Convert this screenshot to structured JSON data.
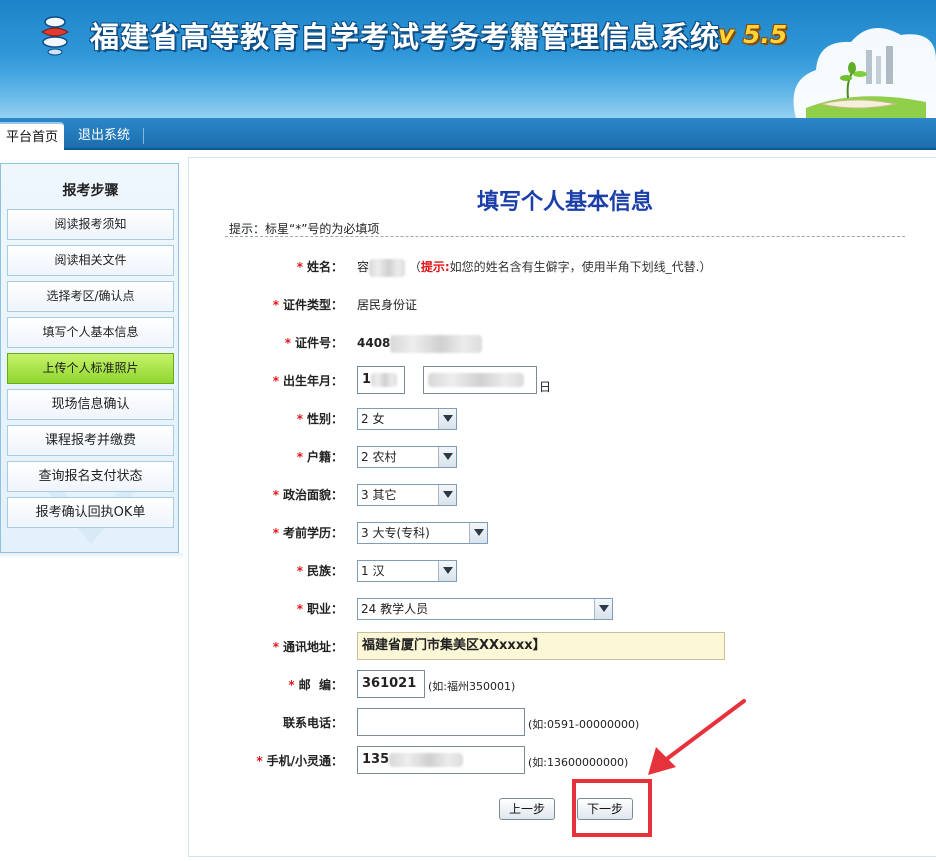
{
  "header": {
    "title": "福建省高等教育自学考试考务考籍管理信息系统",
    "version": "v 5.5"
  },
  "nav": {
    "tabs": [
      {
        "label": "平台首页",
        "active": true
      },
      {
        "label": "退出系统",
        "active": false
      }
    ]
  },
  "sidebar": {
    "title": "报考步骤",
    "steps": [
      {
        "label": "阅读报考须知"
      },
      {
        "label": "阅读相关文件"
      },
      {
        "label": "选择考区/确认点"
      },
      {
        "label": "填写个人基本信息"
      },
      {
        "label": "上传个人标准照片"
      },
      {
        "label": "现场信息确认"
      },
      {
        "label": "课程报考并缴费"
      },
      {
        "label": "查询报名支付状态"
      },
      {
        "label": "报考确认回执OK单"
      }
    ],
    "active_step": "上传个人标准照片"
  },
  "form": {
    "title": "填写个人基本信息",
    "hint": "提示：标星“*”号的为必填项",
    "required_mark": "*",
    "name": {
      "label": "姓名：",
      "value_visible": "容",
      "tip_label": "提示:",
      "tip_text": "如您的姓名含有生僻字，使用半角下划线_代替.）",
      "tip_open": "（"
    },
    "id_type": {
      "label": "证件类型：",
      "value": "居民身份证"
    },
    "id_number": {
      "label": "证件号：",
      "value_visible": "4408"
    },
    "birth": {
      "label": "出生年月：",
      "year_visible": "1",
      "day_suffix": "日"
    },
    "gender": {
      "label": "性别：",
      "value": "2 女"
    },
    "hukou": {
      "label": "户籍：",
      "value": "2 农村"
    },
    "politics": {
      "label": "政治面貌：",
      "value": "3 其它"
    },
    "education": {
      "label": "考前学历：",
      "value": "3 大专(专科)"
    },
    "ethnicity": {
      "label": "民族：",
      "value": "1 汉"
    },
    "occupation": {
      "label": "职业：",
      "value": "24 教学人员"
    },
    "address": {
      "label": "通讯地址：",
      "value": "福建省厦门市集美区XXxxxx】"
    },
    "postcode": {
      "label": "邮  编：",
      "value": "361021",
      "example": "(如:福州350001)"
    },
    "phone": {
      "label": "联系电话：",
      "value": "",
      "example": "(如:0591-00000000)"
    },
    "mobile": {
      "label": "手机/小灵通：",
      "value_visible": "135",
      "example": "(如:13600000000)"
    }
  },
  "buttons": {
    "prev": "上一步",
    "next": "下一步"
  },
  "colors": {
    "header_blue": "#2f97d8",
    "title_blue": "#1b3ea8",
    "required_red": "#e0161b",
    "active_step_green": "#8fd62f",
    "highlight_red": "#e6323a",
    "address_bg": "#fcf7d6"
  }
}
